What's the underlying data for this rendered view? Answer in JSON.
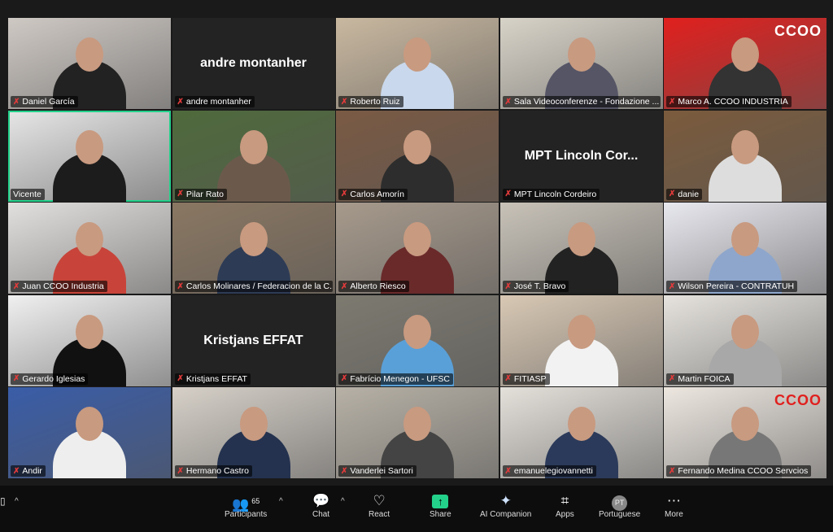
{
  "participants": [
    {
      "name": "Daniel García",
      "muted": true,
      "bg": "#cfc9c4",
      "shirt": "#222"
    },
    {
      "name": "andre montanher",
      "muted": true,
      "video_off": true,
      "display": "andre montanher"
    },
    {
      "name": "Roberto Ruiz",
      "muted": true,
      "bg": "#c9b8a0",
      "shirt": "#c9d8ec"
    },
    {
      "name": "Sala Videoconferenze - Fondazione ...",
      "muted": true,
      "bg": "#d8d3c8",
      "shirt": "#556"
    },
    {
      "name": "Marco A. CCOO INDUSTRIA",
      "muted": true,
      "bg": "#e0201e",
      "shirt": "#333",
      "logo": "CCOO industria"
    },
    {
      "name": "Vicente",
      "muted": false,
      "active": true,
      "bg": "#e6e6e6",
      "shirt": "#1c1c1c"
    },
    {
      "name": "Pilar Rato",
      "muted": true,
      "bg": "#4f6a3c",
      "shirt": "#6b5a4c"
    },
    {
      "name": "Carlos Amorín",
      "muted": true,
      "bg": "#7a5a44",
      "shirt": "#2d2d2d"
    },
    {
      "name": "MPT Lincoln Cordeiro",
      "muted": true,
      "video_off": true,
      "display": "MPT Lincoln Cor..."
    },
    {
      "name": "danie",
      "muted": true,
      "bg": "#7b5b3d",
      "shirt": "#ddd"
    },
    {
      "name": "Juan CCOO Industria",
      "muted": true,
      "bg": "#e2e0de",
      "shirt": "#c8443a"
    },
    {
      "name": "Carlos Molinares / Federacion de la C...",
      "muted": true,
      "bg": "#8a7762",
      "shirt": "#2d3b55"
    },
    {
      "name": "Alberto Riesco",
      "muted": true,
      "bg": "#a79a8c",
      "shirt": "#6a2a2a"
    },
    {
      "name": "José T. Bravo",
      "muted": true,
      "bg": "#c8c2b8",
      "shirt": "#222"
    },
    {
      "name": "Wilson Pereira - CONTRATUH",
      "muted": true,
      "bg": "#e8e8ef",
      "shirt": "#8ea6cc"
    },
    {
      "name": "Gerardo Iglesias",
      "muted": true,
      "bg": "#f0f0f0",
      "shirt": "#111"
    },
    {
      "name": "Kristjans EFFAT",
      "muted": true,
      "video_off": true,
      "display": "Kristjans EFFAT"
    },
    {
      "name": "Fabrício Menegon - UFSC",
      "muted": true,
      "bg": "#7d7a70",
      "shirt": "#5aa0d8"
    },
    {
      "name": "FITIASP",
      "muted": true,
      "bg": "#d8c8b4",
      "shirt": "#f2f2f2"
    },
    {
      "name": "Martin FOICA",
      "muted": true,
      "bg": "#e6e3de",
      "shirt": "#a8a8a8"
    },
    {
      "name": "Andir",
      "muted": true,
      "bg": "#3a5da8",
      "shirt": "#eee"
    },
    {
      "name": "Hermano Castro",
      "muted": true,
      "bg": "#d6d0c8",
      "shirt": "#24324f"
    },
    {
      "name": "Vanderlei Sartori",
      "muted": true,
      "bg": "#b7b1a6",
      "shirt": "#444"
    },
    {
      "name": "emanuelegiovannetti",
      "muted": true,
      "bg": "#e4e0da",
      "shirt": "#2b3a5a"
    },
    {
      "name": "Fernando Medina CCOO Servcios",
      "muted": true,
      "bg": "#ede7e0",
      "shirt": "#777",
      "logo": "CCOO servicios"
    }
  ],
  "toolbar": {
    "participants_count": "65",
    "items": [
      {
        "label": "Participants",
        "icon": "participants-icon"
      },
      {
        "label": "Chat",
        "icon": "chat-icon"
      },
      {
        "label": "React",
        "icon": "heart-icon"
      },
      {
        "label": "Share",
        "icon": "share-icon"
      },
      {
        "label": "AI Companion",
        "icon": "sparkle-icon"
      },
      {
        "label": "Apps",
        "icon": "apps-icon"
      },
      {
        "label": "Portuguese",
        "icon": "language-icon",
        "badge": "PT"
      },
      {
        "label": "More",
        "icon": "more-icon"
      }
    ]
  },
  "colors": {
    "active_speaker": "#23d18b",
    "share": "#23d18b",
    "muted": "#e23b3b"
  }
}
